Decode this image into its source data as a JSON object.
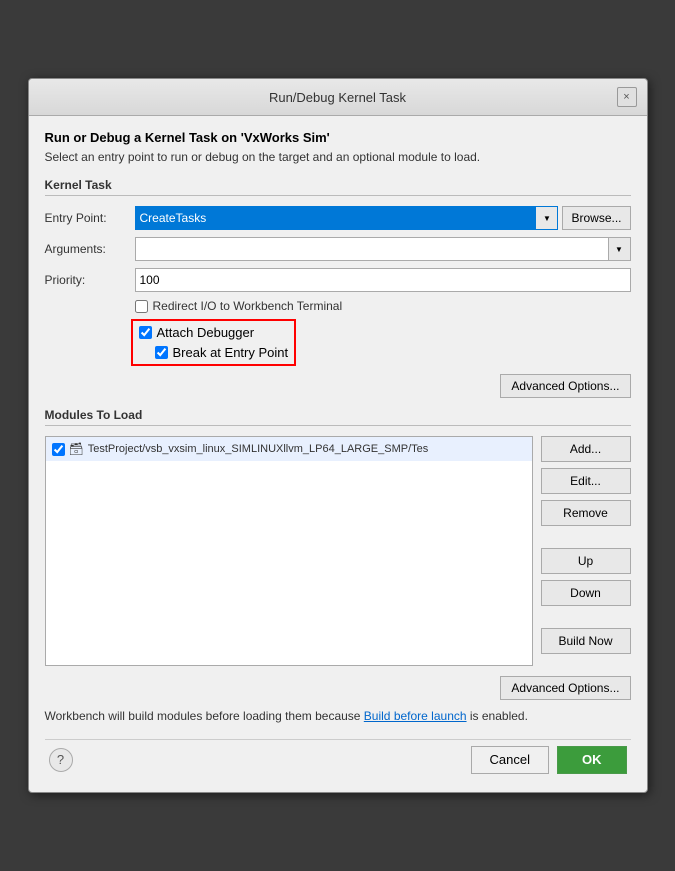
{
  "dialog": {
    "title": "Run/Debug Kernel Task",
    "header_title": "Run or Debug a Kernel Task on 'VxWorks Sim'",
    "description": "Select an entry point to run or debug on the target and an optional module to load.",
    "close_label": "×",
    "kernel_task_section": "Kernel Task",
    "entry_point_label": "Entry Point:",
    "entry_point_value": "CreateTasks",
    "browse_label": "Browse...",
    "arguments_label": "Arguments:",
    "priority_label": "Priority:",
    "priority_value": "100",
    "redirect_io_label": "Redirect I/O to Workbench Terminal",
    "attach_debugger_label": "Attach Debugger",
    "break_at_entry_label": "Break at Entry Point",
    "advanced_options_label": "Advanced Options...",
    "modules_section": "Modules To Load",
    "module_item": "TestProject/vsb_vxsim_linux_SIMLINUXllvm_LP64_LARGE_SMP/Tes",
    "add_label": "Add...",
    "edit_label": "Edit...",
    "remove_label": "Remove",
    "up_label": "Up",
    "down_label": "Down",
    "build_now_label": "Build Now",
    "advanced_options2_label": "Advanced Options...",
    "info_text_before": "Workbench will build modules before loading them because ",
    "info_link": "Build before launch",
    "info_text_after": " is enabled.",
    "cancel_label": "Cancel",
    "ok_label": "OK",
    "help_label": "?"
  }
}
